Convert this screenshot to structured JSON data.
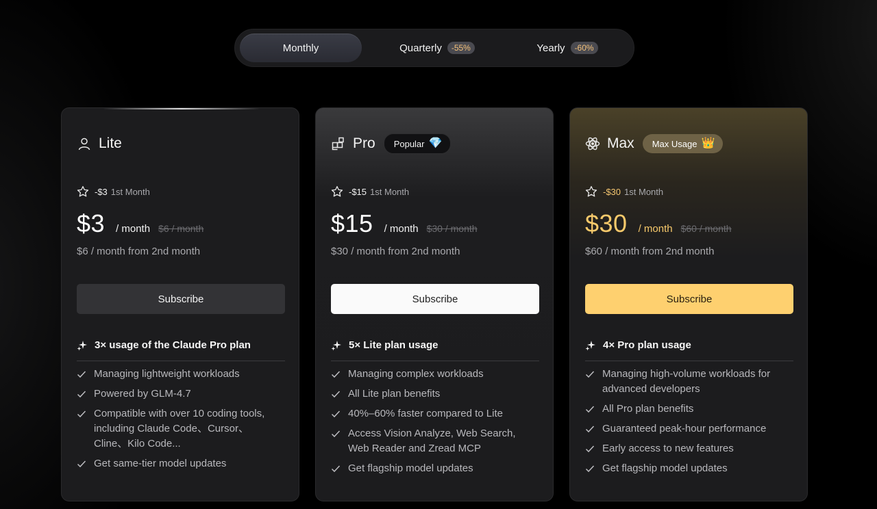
{
  "billing": {
    "options": [
      {
        "label": "Monthly",
        "discount": ""
      },
      {
        "label": "Quarterly",
        "discount": "-55%"
      },
      {
        "label": "Yearly",
        "discount": "-60%"
      }
    ],
    "selected": "Monthly"
  },
  "colors": {
    "accent_gold": "#f7c96b",
    "subscribe_gold": "#fed06f",
    "card_bg": "#1c1c1e"
  },
  "plans": [
    {
      "name": "Lite",
      "icon": "user-icon",
      "tag": "",
      "promo_discount": "-$3",
      "promo_note": "1st Month",
      "price": "$3",
      "per": "/ month",
      "original": "$6 / month",
      "renew": "$6 / month from 2nd month",
      "subscribe_label": "Subscribe",
      "feature_head": "3× usage of the Claude Pro plan",
      "features": [
        "Managing lightweight workloads",
        "Powered by GLM-4.7",
        "Compatible with over 10 coding tools, including Claude Code、Cursor、Cline、Kilo Code...",
        "Get same-tier model updates"
      ]
    },
    {
      "name": "Pro",
      "icon": "grid-blocks-icon",
      "tag": "Popular",
      "tag_icon": "💎",
      "promo_discount": "-$15",
      "promo_note": "1st Month",
      "price": "$15",
      "per": "/ month",
      "original": "$30 / month",
      "renew": "$30 / month from 2nd month",
      "subscribe_label": "Subscribe",
      "feature_head": "5× Lite plan usage",
      "features": [
        "Managing complex workloads",
        "All Lite plan benefits",
        "40%–60% faster compared to Lite",
        "Access Vision Analyze, Web Search, Web Reader and Zread MCP",
        "Get flagship model updates"
      ]
    },
    {
      "name": "Max",
      "icon": "atom-icon",
      "tag": "Max Usage",
      "tag_icon": "👑",
      "promo_discount": "-$30",
      "promo_note": "1st Month",
      "price": "$30",
      "per": "/ month",
      "original": "$60 / month",
      "renew": "$60 / month from 2nd month",
      "subscribe_label": "Subscribe",
      "feature_head": "4× Pro plan usage",
      "features": [
        "Managing high-volume workloads for advanced developers",
        "All Pro plan benefits",
        "Guaranteed peak-hour performance",
        "Early access to new features",
        "Get flagship model updates"
      ]
    }
  ]
}
